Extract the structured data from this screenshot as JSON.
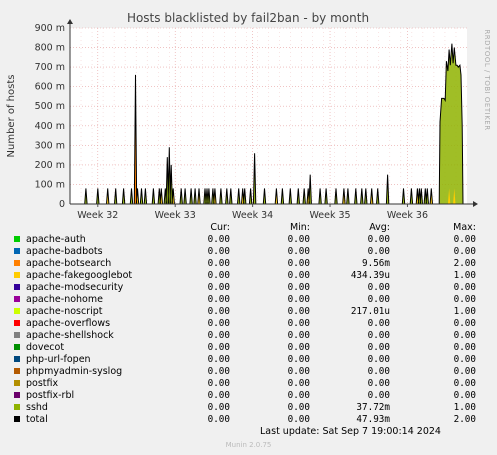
{
  "chart_data": {
    "type": "line",
    "title": "Hosts blacklisted by fail2ban - by month",
    "ylabel": "Number of hosts",
    "side_label": "RRDTOOL / TOBI OETIKER",
    "y_ticks": [
      "0",
      "100 m",
      "200 m",
      "300 m",
      "400 m",
      "500 m",
      "600 m",
      "700 m",
      "800 m",
      "900 m"
    ],
    "ylim": [
      0,
      0.9
    ],
    "x_ticks": [
      "Week 32",
      "Week 33",
      "Week 34",
      "Week 35",
      "Week 36"
    ],
    "xlim": [
      0,
      1
    ],
    "x_tick_positions": [
      0.07,
      0.265,
      0.46,
      0.655,
      0.85
    ],
    "grid": true,
    "spikes": [
      [
        0.04,
        0.08
      ],
      [
        0.07,
        0.08
      ],
      [
        0.095,
        0.08
      ],
      [
        0.115,
        0.08
      ],
      [
        0.135,
        0.08
      ],
      [
        0.155,
        0.08
      ],
      [
        0.165,
        0.66
      ],
      [
        0.17,
        0.08
      ],
      [
        0.18,
        0.08
      ],
      [
        0.19,
        0.08
      ],
      [
        0.21,
        0.08
      ],
      [
        0.225,
        0.08
      ],
      [
        0.23,
        0.08
      ],
      [
        0.24,
        0.08
      ],
      [
        0.245,
        0.24
      ],
      [
        0.25,
        0.29
      ],
      [
        0.255,
        0.2
      ],
      [
        0.26,
        0.08
      ],
      [
        0.28,
        0.08
      ],
      [
        0.29,
        0.08
      ],
      [
        0.305,
        0.08
      ],
      [
        0.315,
        0.08
      ],
      [
        0.325,
        0.08
      ],
      [
        0.34,
        0.08
      ],
      [
        0.345,
        0.08
      ],
      [
        0.35,
        0.08
      ],
      [
        0.36,
        0.08
      ],
      [
        0.365,
        0.08
      ],
      [
        0.38,
        0.08
      ],
      [
        0.395,
        0.08
      ],
      [
        0.405,
        0.08
      ],
      [
        0.425,
        0.08
      ],
      [
        0.435,
        0.08
      ],
      [
        0.44,
        0.08
      ],
      [
        0.455,
        0.08
      ],
      [
        0.465,
        0.26
      ],
      [
        0.49,
        0.08
      ],
      [
        0.52,
        0.08
      ],
      [
        0.535,
        0.08
      ],
      [
        0.555,
        0.08
      ],
      [
        0.575,
        0.08
      ],
      [
        0.59,
        0.08
      ],
      [
        0.6,
        0.08
      ],
      [
        0.605,
        0.15
      ],
      [
        0.63,
        0.08
      ],
      [
        0.645,
        0.08
      ],
      [
        0.67,
        0.08
      ],
      [
        0.69,
        0.08
      ],
      [
        0.7,
        0.08
      ],
      [
        0.72,
        0.08
      ],
      [
        0.735,
        0.08
      ],
      [
        0.745,
        0.08
      ],
      [
        0.76,
        0.08
      ],
      [
        0.775,
        0.08
      ],
      [
        0.8,
        0.15
      ],
      [
        0.84,
        0.08
      ],
      [
        0.86,
        0.08
      ],
      [
        0.875,
        0.08
      ],
      [
        0.88,
        0.08
      ],
      [
        0.885,
        0.08
      ],
      [
        0.895,
        0.08
      ],
      [
        0.9,
        0.08
      ],
      [
        0.91,
        0.08
      ]
    ],
    "final_block": [
      [
        0.93,
        0.0
      ],
      [
        0.932,
        0.42
      ],
      [
        0.936,
        0.54
      ],
      [
        0.942,
        0.54
      ],
      [
        0.945,
        0.53
      ],
      [
        0.948,
        0.73
      ],
      [
        0.952,
        0.68
      ],
      [
        0.955,
        0.79
      ],
      [
        0.958,
        0.71
      ],
      [
        0.962,
        0.82
      ],
      [
        0.965,
        0.72
      ],
      [
        0.968,
        0.8
      ],
      [
        0.972,
        0.71
      ],
      [
        0.975,
        0.71
      ],
      [
        0.978,
        0.7
      ],
      [
        0.982,
        0.71
      ],
      [
        0.985,
        0.66
      ],
      [
        0.988,
        0.4
      ],
      [
        0.99,
        0.0
      ]
    ],
    "series": [
      {
        "name": "apache-auth",
        "color": "#00cc00",
        "cur": "0.00",
        "min": "0.00",
        "avg": "0.00",
        "max": "0.00"
      },
      {
        "name": "apache-badbots",
        "color": "#0066b3",
        "cur": "0.00",
        "min": "0.00",
        "avg": "0.00",
        "max": "0.00"
      },
      {
        "name": "apache-botsearch",
        "color": "#ff8000",
        "cur": "0.00",
        "min": "0.00",
        "avg": "9.56m",
        "max": "2.00"
      },
      {
        "name": "apache-fakegooglebot",
        "color": "#ffcc00",
        "cur": "0.00",
        "min": "0.00",
        "avg": "434.39u",
        "max": "1.00"
      },
      {
        "name": "apache-modsecurity",
        "color": "#330099",
        "cur": "0.00",
        "min": "0.00",
        "avg": "0.00",
        "max": "0.00"
      },
      {
        "name": "apache-nohome",
        "color": "#990099",
        "cur": "0.00",
        "min": "0.00",
        "avg": "0.00",
        "max": "0.00"
      },
      {
        "name": "apache-noscript",
        "color": "#ccff00",
        "cur": "0.00",
        "min": "0.00",
        "avg": "217.01u",
        "max": "1.00"
      },
      {
        "name": "apache-overflows",
        "color": "#ff0000",
        "cur": "0.00",
        "min": "0.00",
        "avg": "0.00",
        "max": "0.00"
      },
      {
        "name": "apache-shellshock",
        "color": "#808080",
        "cur": "0.00",
        "min": "0.00",
        "avg": "0.00",
        "max": "0.00"
      },
      {
        "name": "dovecot",
        "color": "#008f00",
        "cur": "0.00",
        "min": "0.00",
        "avg": "0.00",
        "max": "0.00"
      },
      {
        "name": "php-url-fopen",
        "color": "#00487d",
        "cur": "0.00",
        "min": "0.00",
        "avg": "0.00",
        "max": "0.00"
      },
      {
        "name": "phpmyadmin-syslog",
        "color": "#b35a00",
        "cur": "0.00",
        "min": "0.00",
        "avg": "0.00",
        "max": "0.00"
      },
      {
        "name": "postfix",
        "color": "#b38f00",
        "cur": "0.00",
        "min": "0.00",
        "avg": "0.00",
        "max": "0.00"
      },
      {
        "name": "postfix-rbl",
        "color": "#6b006b",
        "cur": "0.00",
        "min": "0.00",
        "avg": "0.00",
        "max": "0.00"
      },
      {
        "name": "sshd",
        "color": "#8fb300",
        "cur": "0.00",
        "min": "0.00",
        "avg": "37.72m",
        "max": "1.00"
      },
      {
        "name": "total",
        "color": "#000000",
        "cur": "0.00",
        "min": "0.00",
        "avg": "47.93m",
        "max": "2.00"
      }
    ]
  },
  "legend": {
    "cur": "Cur:",
    "min": "Min:",
    "avg": "Avg:",
    "max": "Max:"
  },
  "footer": {
    "last_update": "Last update: Sat Sep  7 19:00:14 2024",
    "munin": "Munin 2.0.75"
  }
}
